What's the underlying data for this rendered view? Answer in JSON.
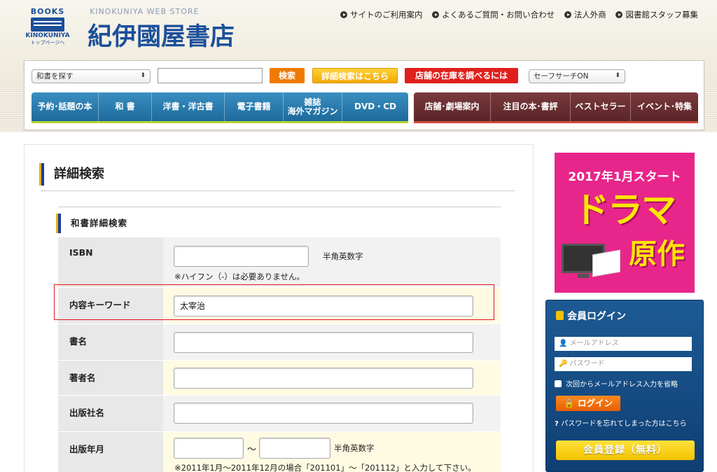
{
  "header": {
    "logo": {
      "line1": "BOOKS",
      "line2": "KINOKUNIYA",
      "line3": "トップページへ"
    },
    "store_en": "KINOKUNIYA WEB STORE",
    "store_jp": "紀伊國屋書店",
    "links": [
      "サイトのご利用案内",
      "よくあるご質問・お問い合わせ",
      "法人外商",
      "図書館スタッフ募集"
    ]
  },
  "searchbar": {
    "category_select": "和書を探す",
    "query": "",
    "search_button": "検索",
    "advanced_button": "詳細検索はこちら",
    "store_stock_button": "店舗の在庫を調べるには",
    "safesearch_select": "セーフサーチON"
  },
  "nav_left": [
    "予約･話題の本",
    "和 書",
    "洋書・洋古書",
    "電子書籍",
    "雑誌\n海外マガジン",
    "DVD・CD"
  ],
  "nav_right": [
    "店舗･劇場案内",
    "注目の本･書評",
    "ベストセラー",
    "イベント･特集"
  ],
  "main": {
    "title": "詳細検索",
    "section_title": "和書詳細検索",
    "isbn": {
      "label": "ISBN",
      "value": "",
      "unit": "半角英数字",
      "note": "※ハイフン（-）は必要ありません。"
    },
    "keyword": {
      "label": "内容キーワード",
      "value": "太宰治"
    },
    "title_field": {
      "label": "書名",
      "value": ""
    },
    "author": {
      "label": "著者名",
      "value": ""
    },
    "publisher": {
      "label": "出版社名",
      "value": ""
    },
    "pubdate": {
      "label": "出版年月",
      "from": "",
      "sep": "～",
      "to": "",
      "unit": "半角英数字",
      "note": "※2011年1月～2011年12月の場合「201101」～「201112」と入力して下さい。"
    }
  },
  "ad": {
    "line1": "2017年1月スタート",
    "line2": "ドラマ",
    "line3": "原作"
  },
  "login": {
    "title": "会員ログイン",
    "email_placeholder": "メールアドレス",
    "password_placeholder": "パスワード",
    "remember": "次回からメールアドレス入力を省略",
    "login_button": "ログイン",
    "forgot": "パスワードを忘れてしまった方はこちら",
    "register_button": "会員登録（無料）"
  },
  "colors": {
    "brand_blue": "#1b4f9a",
    "orange": "#f07a00",
    "red": "#e0201e",
    "nav_blue": "#1d6a9c",
    "nav_maroon": "#5b2427",
    "highlight": "#e0141a"
  }
}
